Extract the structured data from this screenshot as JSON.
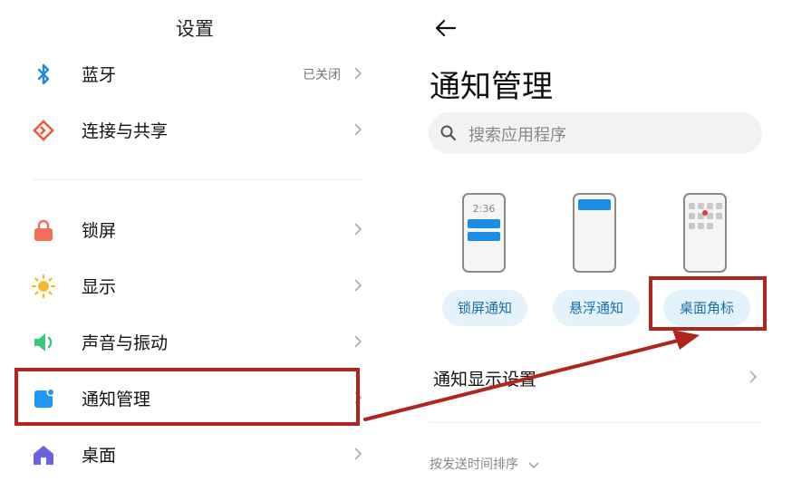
{
  "left_panel": {
    "title": "设置",
    "items": [
      {
        "label": "蓝牙",
        "value": "已关闭",
        "icon": "bluetooth-icon"
      },
      {
        "label": "连接与共享",
        "icon": "share-icon"
      },
      {
        "label": "锁屏",
        "icon": "lock-icon"
      },
      {
        "label": "显示",
        "icon": "sun-icon"
      },
      {
        "label": "声音与振动",
        "icon": "speaker-icon"
      },
      {
        "label": "通知管理",
        "icon": "notification-icon"
      },
      {
        "label": "桌面",
        "icon": "home-icon"
      }
    ]
  },
  "right_panel": {
    "title": "通知管理",
    "search_placeholder": "搜索应用程序",
    "styles": [
      {
        "label": "锁屏通知",
        "phone_time": "2:36"
      },
      {
        "label": "悬浮通知"
      },
      {
        "label": "桌面角标"
      }
    ],
    "display_settings_label": "通知显示设置",
    "sort_label": "按发送时间排序"
  },
  "colors": {
    "highlight": "#b0261f",
    "accent": "#1a8ee6",
    "pill_bg": "#e3f2fb"
  }
}
